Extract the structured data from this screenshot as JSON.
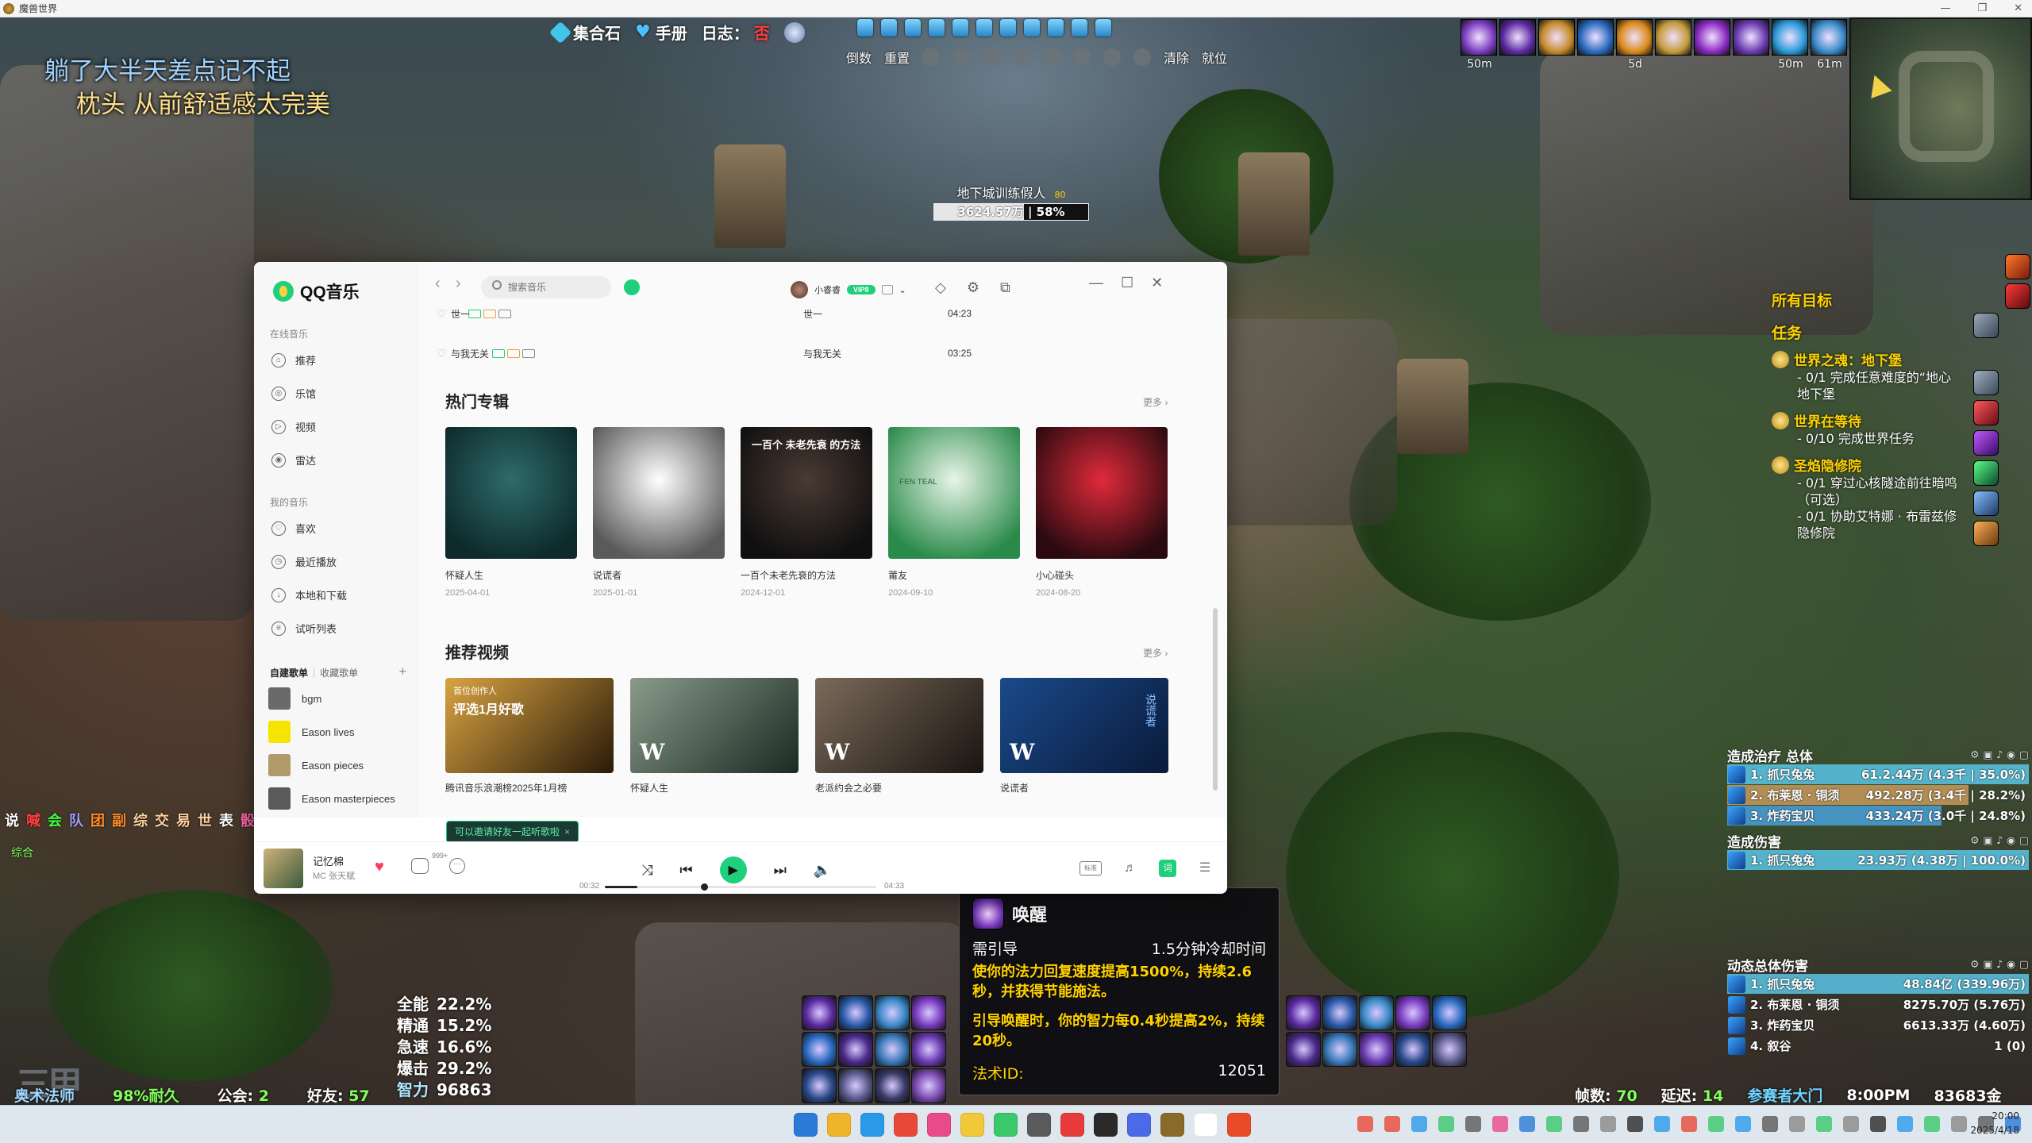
{
  "window": {
    "title": "魔兽世界",
    "minimize": "—",
    "restore": "❐",
    "close": "✕"
  },
  "overlay": {
    "line1": "躺了大半天差点记不起",
    "line2": "枕头 从前舒适感太完美"
  },
  "top_bar": {
    "collect_stone": "集合石",
    "handbook": "手册",
    "log_label": "日志：",
    "log_value": "否"
  },
  "toolbar_text": {
    "reverse": "倒数",
    "reset": "重置",
    "clear": "清除",
    "ready": "就位"
  },
  "buffs": [
    {
      "color": "#7a3cc0",
      "timer": "50m"
    },
    {
      "color": "#5b2aa0",
      "timer": ""
    },
    {
      "color": "#c48a2a",
      "timer": ""
    },
    {
      "color": "#2a6ac0",
      "timer": ""
    },
    {
      "color": "#d98a1a",
      "timer": "5d"
    },
    {
      "color": "#c49a3a",
      "timer": ""
    },
    {
      "color": "#8a2ac0",
      "timer": ""
    },
    {
      "color": "#6a3ab0",
      "timer": ""
    },
    {
      "color": "#2a9ad8",
      "timer": "50m"
    },
    {
      "color": "#3a8ac8",
      "timer": "61m"
    }
  ],
  "nameplate": {
    "name": "地下城训练假人",
    "level": "80",
    "health_text": "3624.57万 | 58%",
    "health_pct": 58
  },
  "quest_tracker": {
    "header": "所有目标",
    "title": "任务",
    "quests": [
      {
        "name": "世界之魂：地下堡",
        "objectives": [
          "- 0/1 完成任意难度的“地心",
          "地下堡"
        ]
      },
      {
        "name": "世界在等待",
        "objectives": [
          "- 0/10 完成世界任务"
        ]
      },
      {
        "name": "圣焰隐修院",
        "objectives": [
          "- 0/1 穿过心核隧途前往暗鸣",
          "（可选）",
          "- 0/1 协助艾特娜 · 布雷兹修",
          "隐修院"
        ]
      }
    ]
  },
  "healing_meter": {
    "title": "造成治疗 总体",
    "rows": [
      {
        "name": "1. 抓只兔兔",
        "value": "61.2.44万 (4.3千 | 35.0%)",
        "pct": 100,
        "color": "#59c6e6"
      },
      {
        "name": "2. 布莱恩 · 铜须",
        "value": "492.28万 (3.4千 | 28.2%)",
        "pct": 80,
        "color": "#c89a5a"
      },
      {
        "name": "3. 炸药宝贝",
        "value": "433.24万 (3.0千 | 24.8%)",
        "pct": 71,
        "color": "#4aa0d8"
      }
    ]
  },
  "damage_meter": {
    "title": "造成伤害",
    "rows": [
      {
        "name": "1. 抓只兔兔",
        "value": "23.93万 (4.38万 | 100.0%)",
        "pct": 100,
        "color": "#59c6e6"
      }
    ]
  },
  "total_damage_meter": {
    "title": "动态总体伤害",
    "rows": [
      {
        "name": "1. 抓只兔兔",
        "value": "48.84亿 (339.96万)",
        "pct": 100,
        "color": "#59c6e6"
      },
      {
        "name": "2. 布莱恩 · 铜须",
        "value": "8275.70万 (5.76万)",
        "pct": 0,
        "color": "#c89a5a"
      },
      {
        "name": "3. 炸药宝贝",
        "value": "6613.33万 (4.60万)",
        "pct": 0,
        "color": "#4aa0d8"
      },
      {
        "name": "4. 叙谷",
        "value": "1 (0)",
        "pct": 0,
        "color": "#3fbf4a"
      }
    ]
  },
  "stats": [
    {
      "label": "全能",
      "value": "22.2%"
    },
    {
      "label": "精通",
      "value": "15.2%"
    },
    {
      "label": "急速",
      "value": "16.6%"
    },
    {
      "label": "爆击",
      "value": "29.2%"
    },
    {
      "label": "智力",
      "value": "96863"
    }
  ],
  "bottom_status": {
    "name": "奥术法师",
    "durability": "98%耐久",
    "guild_label": "公会: ",
    "guild_value": "2",
    "friends_label": "好友: ",
    "friends_value": "57",
    "id": "190653",
    "logo": "三甲"
  },
  "chat_tabs": [
    {
      "label": "说",
      "color": "#ffffff"
    },
    {
      "label": "喊",
      "color": "#ff4040"
    },
    {
      "label": "会",
      "color": "#3fff3f"
    },
    {
      "label": "队",
      "color": "#a0a0ff"
    },
    {
      "label": "团",
      "color": "#ff8a2a"
    },
    {
      "label": "副",
      "color": "#ff8a2a"
    },
    {
      "label": "综",
      "color": "#ffd0a0"
    },
    {
      "label": "交",
      "color": "#ffd0a0"
    },
    {
      "label": "易",
      "color": "#ffd0a0"
    },
    {
      "label": "世",
      "color": "#ffd0a0"
    },
    {
      "label": "表",
      "color": "#ffffff"
    },
    {
      "label": "骰",
      "color": "#ff6ab0"
    }
  ],
  "chat_sub": "综合",
  "tooltip": {
    "title": "唤醒",
    "req": "需引导",
    "cooldown": "1.5分钟冷却时间",
    "desc1": "使你的法力回复速度提高1500%，持续2.6秒，并获得节能施法。",
    "desc2": "引导唤醒时，你的智力每0.4秒提高2%，持续20秒。",
    "spell_label": "法术ID:",
    "spell_id": "12051"
  },
  "bottom_right": {
    "fps_label": "帧数: ",
    "fps_value": "70",
    "latency_label": "延迟: ",
    "latency_value": "14",
    "zone": "参赛者大门",
    "time": "8:00PM",
    "gold": "83683金"
  },
  "taskbar": {
    "time": "20:00",
    "date": "2025/4/18"
  },
  "qq": {
    "logo": "QQ音乐",
    "sections": {
      "online": "在线音乐",
      "mine": "我的音乐"
    },
    "nav_online": [
      {
        "label": "推荐",
        "icon": "⌂"
      },
      {
        "label": "乐馆",
        "icon": "◎"
      },
      {
        "label": "视频",
        "icon": "▷"
      },
      {
        "label": "雷达",
        "icon": "◉"
      }
    ],
    "nav_mine": [
      {
        "label": "喜欢",
        "icon": "♡"
      },
      {
        "label": "最近播放",
        "icon": "◷"
      },
      {
        "label": "本地和下载",
        "icon": "↓"
      },
      {
        "label": "试听列表",
        "icon": "≡"
      }
    ],
    "playlist_tabs": {
      "created": "自建歌单",
      "collected": "收藏歌单",
      "add": "+"
    },
    "playlists": [
      {
        "name": "bgm",
        "color": "#6a6a6a"
      },
      {
        "name": "Eason lives",
        "color": "#f5e400"
      },
      {
        "name": "Eason pieces",
        "color": "#b09a6a"
      },
      {
        "name": "Eason masterpieces",
        "color": "#5a5a5a"
      }
    ],
    "search_placeholder": "搜索音乐",
    "user": {
      "name": "小睿睿",
      "vip": "VIP8"
    },
    "songs": [
      {
        "title": "世一",
        "album": "世一",
        "duration": "04:23"
      },
      {
        "title": "与我无关",
        "album": "与我无关",
        "duration": "03:25"
      }
    ],
    "hot_albums_title": "热门专辑",
    "more": "更多 ›",
    "albums": [
      {
        "title": "怀疑人生",
        "date": "2025-04-01",
        "c1": "#2e6b6a",
        "c2": "#0e2a2c"
      },
      {
        "title": "说谎者",
        "date": "2025-01-01",
        "c1": "#ffffff",
        "c2": "#5a5a5a"
      },
      {
        "title": "一百个未老先衰的方法",
        "date": "2024-12-01",
        "c1": "#4a3a32",
        "c2": "#101010"
      },
      {
        "title": "莆友",
        "date": "2024-09-10",
        "c1": "#e8f5e8",
        "c2": "#2a8a4a"
      },
      {
        "title": "小心碰头",
        "date": "2024-08-20",
        "c1": "#e02a3a",
        "c2": "#2a0a10"
      }
    ],
    "album3_text": "一百个 未老先衰 的方法",
    "album4_text": "FEN TEAL",
    "recommend_videos_title": "推荐视频",
    "videos": [
      {
        "title": "腾讯音乐浪潮榜2025年1月榜",
        "c1": "#d9a441",
        "c2": "#2a1a0a"
      },
      {
        "title": "怀疑人生",
        "c1": "#8a9a8a",
        "c2": "#1a2a22"
      },
      {
        "title": "老派约会之必要",
        "c1": "#7a6a5a",
        "c2": "#1a1410"
      },
      {
        "title": "说谎者",
        "c1": "#1a4a8a",
        "c2": "#0a1a3a"
      }
    ],
    "video1_overlay": {
      "line1": "首位创作人",
      "line2": "评选1月好歌"
    },
    "w_logo": "W",
    "video4_overlay": "说谎者",
    "invite": "可以邀请好友一起听歌啦",
    "invite_close": "×",
    "player": {
      "song": "记忆棉",
      "artist": "MC 张天赋",
      "comment_count": "999+",
      "time_current": "00:32",
      "time_total": "04:33",
      "progress_pct": 12,
      "quality": "标准",
      "lyric": "词"
    }
  },
  "colors": {
    "qq_green": "#1ecf7b",
    "wow_gold": "#ffd200"
  }
}
